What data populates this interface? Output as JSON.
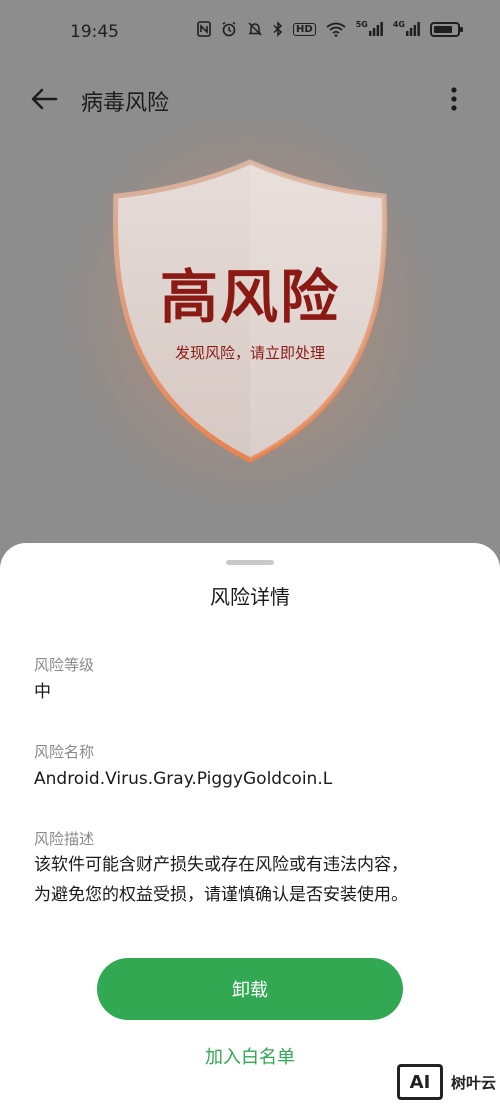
{
  "status_bar": {
    "time": "19:45",
    "icons": [
      "nfc-icon",
      "alarm-icon",
      "mute-icon",
      "bluetooth-icon",
      "hd-icon",
      "wifi-icon",
      "signal-5g-icon",
      "signal-4g-icon",
      "battery-icon"
    ],
    "hd_label": "HD",
    "net1": "5G",
    "net2": "4G"
  },
  "header": {
    "title": "病毒风险"
  },
  "hero": {
    "risk_level_title": "高风险",
    "risk_subtitle": "发现风险，请立即处理"
  },
  "sheet": {
    "title": "风险详情",
    "fields": [
      {
        "label": "风险等级",
        "value": "中"
      },
      {
        "label": "风险名称",
        "value": "Android.Virus.Gray.PiggyGoldcoin.L"
      },
      {
        "label": "风险描述",
        "value_lines": [
          "该软件可能含财产损失或存在风险或有违法内容，",
          "为避免您的权益受损，请谨慎确认是否安装使用。"
        ]
      }
    ],
    "uninstall_label": "卸载",
    "whitelist_label": "加入白名单"
  },
  "watermark": {
    "logo_text": "AI",
    "text": "树叶云"
  },
  "colors": {
    "accent_green": "#33a853",
    "risk_red": "#8b1a14",
    "overlay_gray": "#8d8d8d"
  }
}
